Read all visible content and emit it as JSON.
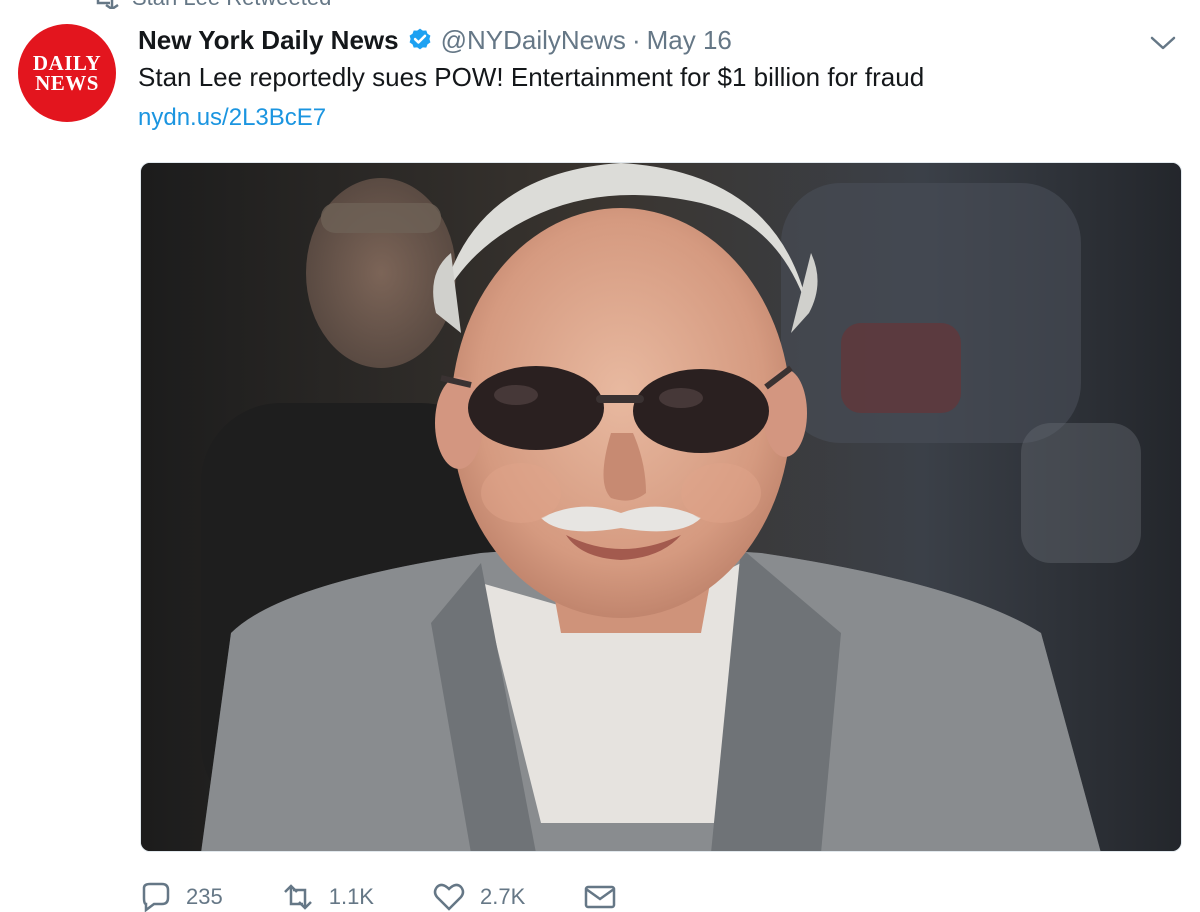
{
  "retweet_context": {
    "text": "Stan Lee Retweeted"
  },
  "tweet": {
    "avatar_line1": "DAILY",
    "avatar_line2": "NEWS",
    "display_name": "New York Daily News",
    "handle": "@NYDailyNews",
    "separator": "·",
    "date": "May 16",
    "text": "Stan Lee reportedly sues POW! Entertainment for $1 billion for fraud",
    "link": "nydn.us/2L3BcE7"
  },
  "actions": {
    "reply_count": "235",
    "retweet_count": "1.1K",
    "like_count": "2.7K"
  },
  "colors": {
    "brand_red": "#e3151e",
    "link_blue": "#1b95e0",
    "verified_blue": "#1da1f2",
    "muted_gray": "#657786"
  }
}
